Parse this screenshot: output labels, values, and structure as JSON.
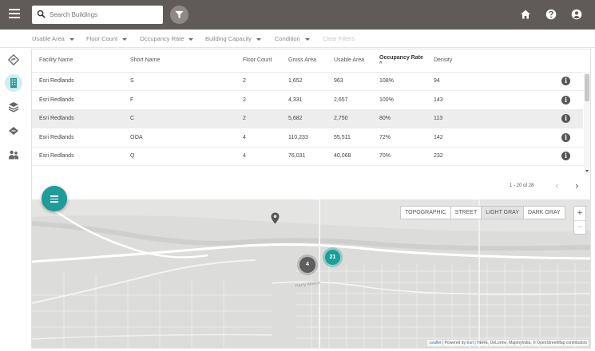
{
  "search": {
    "placeholder": "Search Buildings"
  },
  "filters": [
    {
      "label": "Usable Area"
    },
    {
      "label": "Floor Count"
    },
    {
      "label": "Occupancy Rate"
    },
    {
      "label": "Building Capacity"
    },
    {
      "label": "Condition"
    },
    {
      "label": "Clear Filters"
    }
  ],
  "table": {
    "headers": [
      "Facility Name",
      "Short Name",
      "Floor Count",
      "Gross Area",
      "Usable Area",
      "Occupancy Rate",
      "Density"
    ],
    "sort_indicator": "^",
    "rows": [
      [
        "Esri Redlands",
        "S",
        "2",
        "1,652",
        "963",
        "108%",
        "94"
      ],
      [
        "Esri Redlands",
        "F",
        "2",
        "4,331",
        "2,657",
        "100%",
        "143"
      ],
      [
        "Esri Redlands",
        "C",
        "2",
        "5,682",
        "2,750",
        "80%",
        "113"
      ],
      [
        "Esri Redlands",
        "OOA",
        "4",
        "110,233",
        "55,511",
        "72%",
        "142"
      ],
      [
        "Esri Redlands",
        "Q",
        "4",
        "76,031",
        "40,068",
        "70%",
        "232"
      ]
    ],
    "info_glyph": "i"
  },
  "pager": {
    "range": "1 - 20 of 28",
    "prev": "‹",
    "next": "›"
  },
  "map": {
    "basemaps": [
      "TOPOGRAPHIC",
      "STREET",
      "LIGHT GRAY",
      "DARK GRAY"
    ],
    "active_basemap": "LIGHT GRAY",
    "zoom_in": "+",
    "zoom_out": "−",
    "clusters": {
      "gray": "4",
      "teal": "21"
    },
    "street_label": "Harry Aliston",
    "attribution": {
      "leaflet": "Leaflet",
      "powered": "| Powered by",
      "esri": "Esri",
      "rest": "| HERE, DeLorme, MapmyIndia, © OpenStreetMap contributors"
    }
  },
  "colors": {
    "topbar": "#605a58",
    "accent": "#1e9c9a"
  }
}
